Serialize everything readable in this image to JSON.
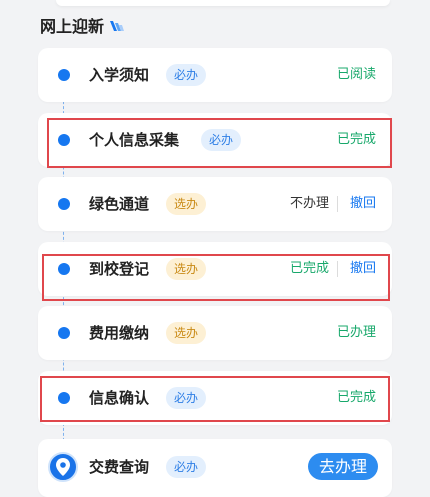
{
  "section": {
    "title": "网上迎新"
  },
  "items": [
    {
      "title": "入学须知",
      "badge": "必办",
      "status": "已阅读"
    },
    {
      "title": "个人信息采集",
      "badge": "必办",
      "status": "已完成"
    },
    {
      "title": "绿色通道",
      "badge": "选办",
      "status": "不办理",
      "action": "撤回"
    },
    {
      "title": "到校登记",
      "badge": "选办",
      "status": "已完成",
      "action": "撤回"
    },
    {
      "title": "费用缴纳",
      "badge": "选办",
      "status": "已办理"
    },
    {
      "title": "信息确认",
      "badge": "必办",
      "status": "已完成"
    },
    {
      "title": "交费查询",
      "badge": "必办",
      "button": "去办理"
    }
  ],
  "colors": {
    "primary": "#1677f0",
    "green": "#18a86b",
    "highlight": "#e0474c",
    "badge_required_bg": "#e3effd",
    "badge_optional_bg": "#fdf0d4"
  }
}
